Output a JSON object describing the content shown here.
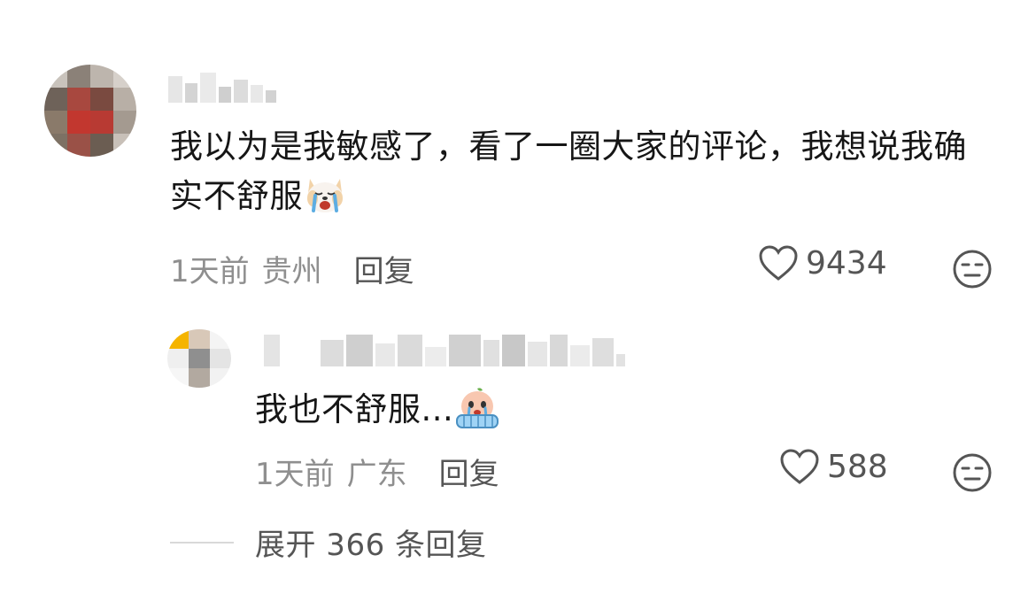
{
  "comment": {
    "text": "我以为是我敏感了，看了一圈大家的评论，我想说我确实不舒服",
    "emoji": "crying-dog-emoji",
    "time": "1天前",
    "location": "贵州",
    "reply_label": "回复",
    "likes": "9434"
  },
  "reply": {
    "text": "我也不舒服...",
    "emoji": "crying-face-emoji",
    "time": "1天前",
    "location": "广东",
    "reply_label": "回复",
    "likes": "588"
  },
  "expand": {
    "label": "展开 366 条回复"
  },
  "icons": {
    "like": "heart-icon",
    "dislike": "meh-face-icon"
  },
  "colors": {
    "meta": "#8f8f8f",
    "action": "#555555",
    "text": "#161616"
  }
}
